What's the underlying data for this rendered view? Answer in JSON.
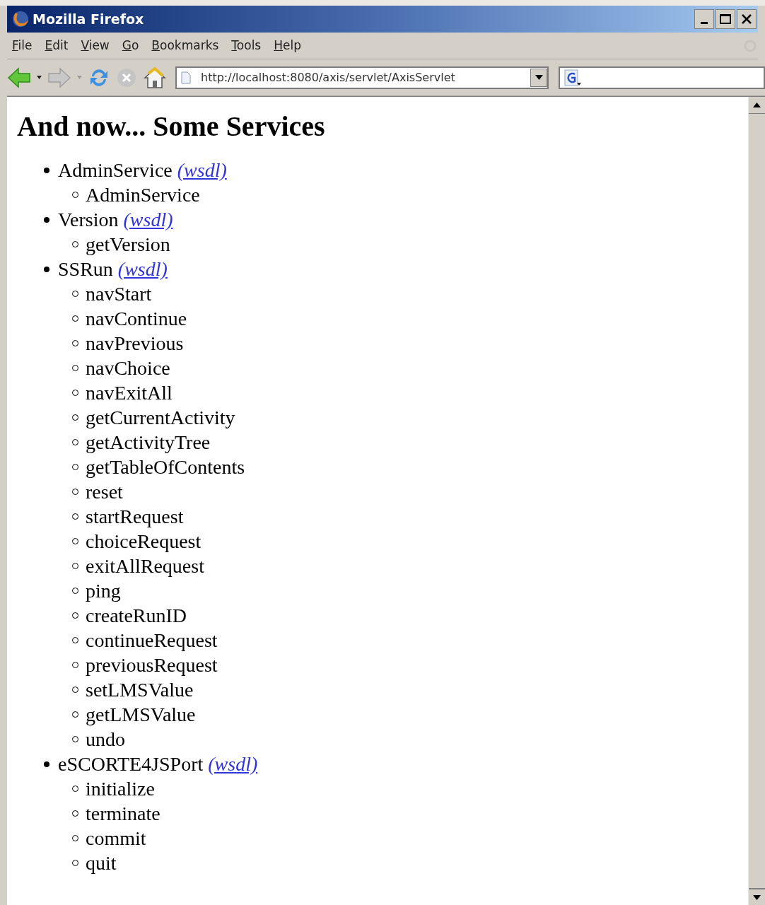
{
  "window": {
    "title": "Mozilla Firefox"
  },
  "menu": [
    "File",
    "Edit",
    "View",
    "Go",
    "Bookmarks",
    "Tools",
    "Help"
  ],
  "address_bar": {
    "value": "http://localhost:8080/axis/servlet/AxisServlet"
  },
  "page": {
    "heading": "And now... Some Services",
    "services": [
      {
        "name": "AdminService",
        "link": "(wsdl)",
        "operations": [
          "AdminService"
        ]
      },
      {
        "name": "Version",
        "link": "(wsdl)",
        "operations": [
          "getVersion"
        ]
      },
      {
        "name": "SSRun",
        "link": "(wsdl)",
        "operations": [
          "navStart",
          "navContinue",
          "navPrevious",
          "navChoice",
          "navExitAll",
          "getCurrentActivity",
          "getActivityTree",
          "getTableOfContents",
          "reset",
          "startRequest",
          "choiceRequest",
          "exitAllRequest",
          "ping",
          "createRunID",
          "continueRequest",
          "previousRequest",
          "setLMSValue",
          "getLMSValue",
          "undo"
        ]
      },
      {
        "name": "eSCORTE4JSPort",
        "link": "(wsdl)",
        "operations": [
          "initialize",
          "terminate",
          "commit",
          "quit"
        ]
      }
    ]
  }
}
